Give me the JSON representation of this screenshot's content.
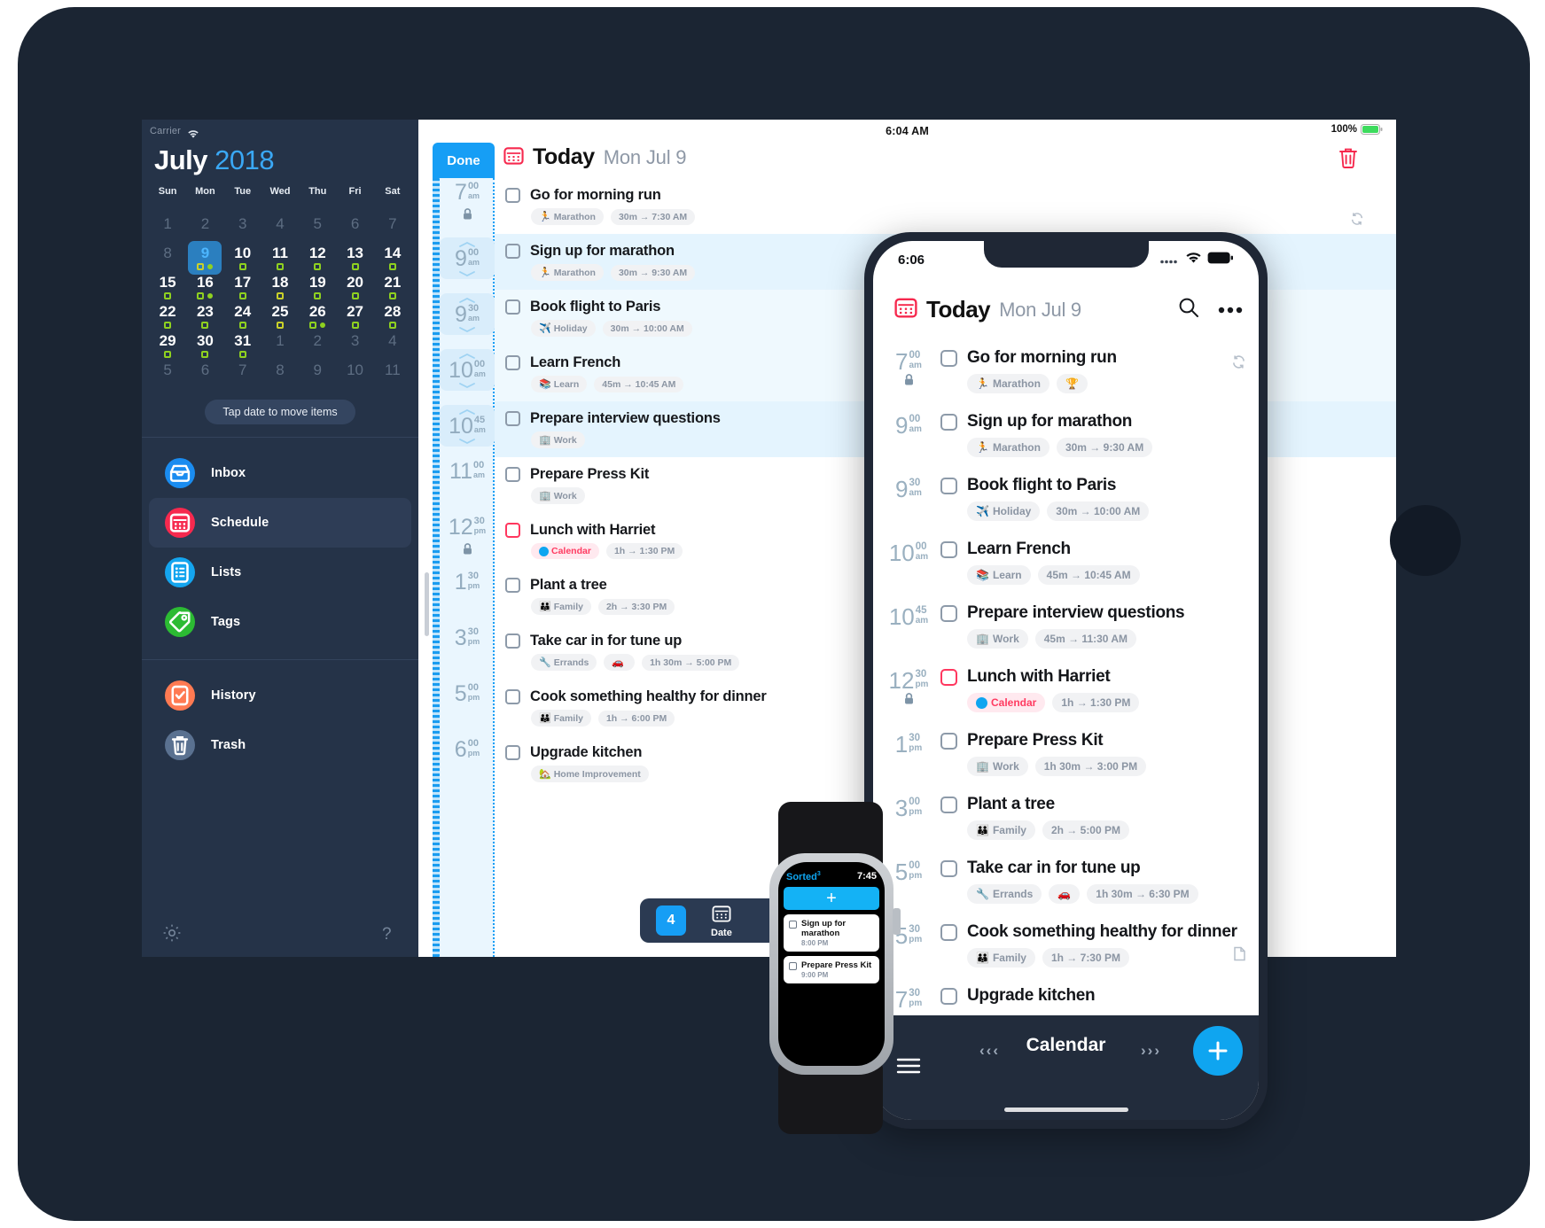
{
  "ipad": {
    "sidebar": {
      "status": {
        "carrier": "Carrier",
        "wifi_icon": "wifi-icon"
      },
      "calendar": {
        "month": "July",
        "year": "2018",
        "weekdays": [
          "Sun",
          "Mon",
          "Tue",
          "Wed",
          "Thu",
          "Fri",
          "Sat"
        ],
        "weeks": [
          [
            {
              "d": "1",
              "dim": true,
              "dots": []
            },
            {
              "d": "2",
              "dim": true,
              "dots": []
            },
            {
              "d": "3",
              "dim": true,
              "dots": []
            },
            {
              "d": "4",
              "dim": true,
              "dots": []
            },
            {
              "d": "5",
              "dim": true,
              "dots": []
            },
            {
              "d": "6",
              "dim": true,
              "dots": []
            },
            {
              "d": "7",
              "dim": true,
              "dots": []
            }
          ],
          [
            {
              "d": "8",
              "dim": true,
              "dots": []
            },
            {
              "d": "9",
              "dim": false,
              "today": true,
              "dots": [
                "square-yellow",
                "round-green"
              ]
            },
            {
              "d": "10",
              "dim": false,
              "dots": [
                "square-green"
              ]
            },
            {
              "d": "11",
              "dim": false,
              "dots": [
                "square-green"
              ]
            },
            {
              "d": "12",
              "dim": false,
              "dots": [
                "square-green"
              ]
            },
            {
              "d": "13",
              "dim": false,
              "dots": [
                "square-green"
              ]
            },
            {
              "d": "14",
              "dim": false,
              "dots": [
                "square-green"
              ]
            }
          ],
          [
            {
              "d": "15",
              "dim": false,
              "dots": [
                "square-green"
              ]
            },
            {
              "d": "16",
              "dim": false,
              "dots": [
                "square-green",
                "round-green"
              ]
            },
            {
              "d": "17",
              "dim": false,
              "dots": [
                "square-green"
              ]
            },
            {
              "d": "18",
              "dim": false,
              "dots": [
                "square-yellow"
              ]
            },
            {
              "d": "19",
              "dim": false,
              "dots": [
                "square-green"
              ]
            },
            {
              "d": "20",
              "dim": false,
              "dots": [
                "square-green"
              ]
            },
            {
              "d": "21",
              "dim": false,
              "dots": [
                "square-green"
              ]
            }
          ],
          [
            {
              "d": "22",
              "dim": false,
              "dots": [
                "square-green"
              ]
            },
            {
              "d": "23",
              "dim": false,
              "dots": [
                "square-green"
              ]
            },
            {
              "d": "24",
              "dim": false,
              "dots": [
                "square-green"
              ]
            },
            {
              "d": "25",
              "dim": false,
              "dots": [
                "square-yellow"
              ]
            },
            {
              "d": "26",
              "dim": false,
              "dots": [
                "square-green",
                "round-green"
              ]
            },
            {
              "d": "27",
              "dim": false,
              "dots": [
                "square-green"
              ]
            },
            {
              "d": "28",
              "dim": false,
              "dots": [
                "square-green"
              ]
            }
          ],
          [
            {
              "d": "29",
              "dim": false,
              "dots": [
                "square-green"
              ]
            },
            {
              "d": "30",
              "dim": false,
              "dots": [
                "square-green"
              ]
            },
            {
              "d": "31",
              "dim": false,
              "dots": [
                "square-green"
              ]
            },
            {
              "d": "1",
              "dim": true,
              "dots": []
            },
            {
              "d": "2",
              "dim": true,
              "dots": []
            },
            {
              "d": "3",
              "dim": true,
              "dots": []
            },
            {
              "d": "4",
              "dim": true,
              "dots": []
            }
          ],
          [
            {
              "d": "5",
              "dim": true,
              "dots": []
            },
            {
              "d": "6",
              "dim": true,
              "dots": []
            },
            {
              "d": "7",
              "dim": true,
              "dots": []
            },
            {
              "d": "8",
              "dim": true,
              "dots": []
            },
            {
              "d": "9",
              "dim": true,
              "dots": []
            },
            {
              "d": "10",
              "dim": true,
              "dots": []
            },
            {
              "d": "11",
              "dim": true,
              "dots": []
            }
          ]
        ],
        "hint": "Tap date to move items"
      },
      "nav": [
        {
          "label": "Inbox",
          "icon": "inbox-icon",
          "color": "#1a8cf0",
          "active": false
        },
        {
          "label": "Schedule",
          "icon": "calendar-icon",
          "color": "#f6294e",
          "active": true
        },
        {
          "label": "Lists",
          "icon": "list-icon",
          "color": "#14a5ef",
          "active": false
        },
        {
          "label": "Tags",
          "icon": "tag-icon",
          "color": "#2cbb33",
          "active": false
        }
      ],
      "nav2": [
        {
          "label": "History",
          "icon": "history-icon",
          "color": "#ff7a52",
          "active": false
        },
        {
          "label": "Trash",
          "icon": "trash-icon",
          "color": "#5a7190",
          "active": false
        }
      ],
      "footer": [
        {
          "icon": "gear-icon"
        },
        {
          "icon": "help-icon"
        }
      ]
    },
    "main": {
      "status": {
        "time": "6:04 AM",
        "battery": "100%"
      },
      "done_label": "Done",
      "header": {
        "icon": "calendar-icon",
        "title": "Today",
        "date": "Mon Jul 9"
      },
      "trash_icon": "trash-icon",
      "tasks": [
        {
          "time_h": "7",
          "time_m": "00",
          "ap": "am",
          "locked": true,
          "stepper": false,
          "title": "Go for morning run",
          "tags": [
            {
              "emoji": "🏃",
              "text": "Marathon"
            },
            {
              "text": "30m → 7:30 AM"
            }
          ],
          "highlight": "",
          "sync": true
        },
        {
          "time_h": "9",
          "time_m": "00",
          "ap": "am",
          "locked": false,
          "stepper": true,
          "title": "Sign up for marathon",
          "tags": [
            {
              "emoji": "🏃",
              "text": "Marathon"
            },
            {
              "text": "30m → 9:30 AM"
            }
          ],
          "highlight": "hl"
        },
        {
          "time_h": "9",
          "time_m": "30",
          "ap": "am",
          "locked": false,
          "stepper": true,
          "title": "Book flight to Paris",
          "tags": [
            {
              "emoji": "✈️",
              "text": "Holiday"
            },
            {
              "text": "30m → 10:00 AM"
            }
          ],
          "highlight": "hl2"
        },
        {
          "time_h": "10",
          "time_m": "00",
          "ap": "am",
          "locked": false,
          "stepper": true,
          "title": "Learn French",
          "tags": [
            {
              "emoji": "📚",
              "text": "Learn"
            },
            {
              "text": "45m → 10:45 AM"
            }
          ],
          "highlight": "hl2"
        },
        {
          "time_h": "10",
          "time_m": "45",
          "ap": "am",
          "locked": false,
          "stepper": true,
          "title": "Prepare interview questions",
          "tags": [
            {
              "emoji": "🏢",
              "text": "Work"
            }
          ],
          "highlight": "hl"
        },
        {
          "time_h": "11",
          "time_m": "00",
          "ap": "am",
          "locked": false,
          "stepper": false,
          "title": "Prepare Press Kit",
          "tags": [
            {
              "emoji": "🏢",
              "text": "Work"
            }
          ],
          "highlight": ""
        },
        {
          "time_h": "12",
          "time_m": "30",
          "ap": "pm",
          "locked": true,
          "stepper": false,
          "title": "Lunch with Harriet",
          "pink": true,
          "tags": [
            {
              "dot": true,
              "text": "Calendar",
              "cal": true
            },
            {
              "text": "1h → 1:30 PM"
            }
          ],
          "highlight": ""
        },
        {
          "time_h": "1",
          "time_m": "30",
          "ap": "pm",
          "locked": false,
          "stepper": false,
          "title": "Plant a tree",
          "tags": [
            {
              "emoji": "👪",
              "text": "Family"
            },
            {
              "text": "2h → 3:30 PM"
            }
          ],
          "highlight": ""
        },
        {
          "time_h": "3",
          "time_m": "30",
          "ap": "pm",
          "locked": false,
          "stepper": false,
          "title": "Take car in for tune up",
          "tags": [
            {
              "emoji": "🔧",
              "text": "Errands"
            },
            {
              "emoji": "🚗",
              "text": ""
            },
            {
              "text": "1h 30m → 5:00 PM"
            }
          ],
          "highlight": ""
        },
        {
          "time_h": "5",
          "time_m": "00",
          "ap": "pm",
          "locked": false,
          "stepper": false,
          "title": "Cook something healthy for dinner",
          "tags": [
            {
              "emoji": "👪",
              "text": "Family"
            },
            {
              "text": "1h → 6:00 PM"
            }
          ],
          "highlight": ""
        },
        {
          "time_h": "6",
          "time_m": "00",
          "ap": "pm",
          "locked": false,
          "stepper": false,
          "title": "Upgrade kitchen",
          "tags": [
            {
              "emoji": "🏡",
              "text": "Home Improvement"
            }
          ],
          "highlight": ""
        }
      ],
      "toolbar": {
        "badge": "4",
        "date_label": "Date",
        "date_icon": "calendar-icon"
      }
    }
  },
  "iphone": {
    "status": {
      "time": "6:06",
      "signal_icon": "signal-icon",
      "wifi_icon": "wifi-icon",
      "battery_icon": "battery-icon"
    },
    "header": {
      "icon": "calendar-icon",
      "title": "Today",
      "date": "Mon Jul 9",
      "search_icon": "search-icon",
      "more_icon": "more-icon"
    },
    "tasks": [
      {
        "time_h": "7",
        "time_m": "00",
        "ap": "am",
        "locked": true,
        "title": "Go for morning run",
        "tags": [
          {
            "emoji": "🏃",
            "text": "Marathon"
          },
          {
            "emoji": "🏆",
            "text": ""
          }
        ],
        "sync": true
      },
      {
        "time_h": "9",
        "time_m": "00",
        "ap": "am",
        "locked": false,
        "title": "Sign up for marathon",
        "tags": [
          {
            "emoji": "🏃",
            "text": "Marathon"
          },
          {
            "text": "30m → 9:30 AM"
          }
        ]
      },
      {
        "time_h": "9",
        "time_m": "30",
        "ap": "am",
        "locked": false,
        "title": "Book flight to Paris",
        "tags": [
          {
            "emoji": "✈️",
            "text": "Holiday"
          },
          {
            "text": "30m → 10:00 AM"
          }
        ]
      },
      {
        "time_h": "10",
        "time_m": "00",
        "ap": "am",
        "locked": false,
        "title": "Learn French",
        "tags": [
          {
            "emoji": "📚",
            "text": "Learn"
          },
          {
            "text": "45m → 10:45 AM"
          }
        ]
      },
      {
        "time_h": "10",
        "time_m": "45",
        "ap": "am",
        "locked": false,
        "title": "Prepare interview questions",
        "tags": [
          {
            "emoji": "🏢",
            "text": "Work"
          },
          {
            "text": "45m → 11:30 AM"
          }
        ]
      },
      {
        "time_h": "12",
        "time_m": "30",
        "ap": "pm",
        "locked": true,
        "title": "Lunch with Harriet",
        "pink": true,
        "tags": [
          {
            "dot": true,
            "text": "Calendar",
            "cal": true
          },
          {
            "text": "1h → 1:30 PM"
          }
        ]
      },
      {
        "time_h": "1",
        "time_m": "30",
        "ap": "pm",
        "locked": false,
        "title": "Prepare Press Kit",
        "tags": [
          {
            "emoji": "🏢",
            "text": "Work"
          },
          {
            "text": "1h 30m → 3:00 PM"
          }
        ]
      },
      {
        "time_h": "3",
        "time_m": "00",
        "ap": "pm",
        "locked": false,
        "title": "Plant a tree",
        "tags": [
          {
            "emoji": "👪",
            "text": "Family"
          },
          {
            "text": "2h → 5:00 PM"
          }
        ]
      },
      {
        "time_h": "5",
        "time_m": "00",
        "ap": "pm",
        "locked": false,
        "title": "Take car in for tune up",
        "tags": [
          {
            "emoji": "🔧",
            "text": "Errands"
          },
          {
            "emoji": "🚗",
            "text": ""
          },
          {
            "text": "1h 30m → 6:30 PM"
          }
        ]
      },
      {
        "time_h": "5",
        "time_m": "30",
        "ap": "pm",
        "locked": false,
        "title": "Cook something healthy for dinner",
        "tags": [
          {
            "emoji": "👪",
            "text": "Family"
          },
          {
            "text": "1h → 7:30 PM"
          }
        ],
        "note": true
      },
      {
        "time_h": "7",
        "time_m": "30",
        "ap": "pm",
        "locked": false,
        "title": "Upgrade kitchen",
        "tags": []
      }
    ],
    "bottom": {
      "menu_icon": "menu-icon",
      "label": "Calendar",
      "left_arrows": "‹‹‹",
      "right_arrows": "›››",
      "fab_icon": "plus-icon"
    }
  },
  "watch": {
    "brand": "Sorted",
    "brand_sup": "3",
    "time": "7:45",
    "add_icon": "plus-icon",
    "items": [
      {
        "title": "Sign up for marathon",
        "time": "8:00 PM"
      },
      {
        "title": "Prepare Press Kit",
        "time": "9:00 PM"
      }
    ]
  },
  "colors": {
    "accent_blue": "#169ef5",
    "accent_pink": "#ff375f",
    "dark_navy": "#253348",
    "green_dot": "#8fd120"
  }
}
